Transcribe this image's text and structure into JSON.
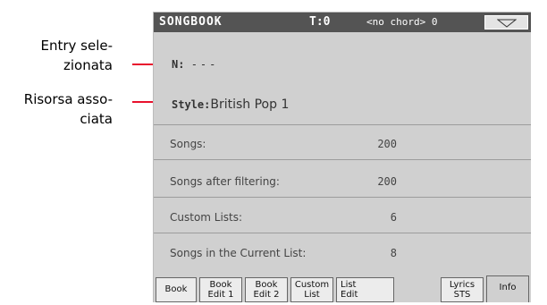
{
  "callouts": [
    {
      "text": "Entry sele-\nzionata"
    },
    {
      "text": "Risorsa asso-\nciata"
    }
  ],
  "titlebar": {
    "title": "SONGBOOK",
    "tempo": "T:0",
    "chord": "<no chord> 0",
    "menu_icon": "triangle-down-icon"
  },
  "entry": {
    "label": "N:",
    "value": "---"
  },
  "style": {
    "label": "Style:",
    "value": "British Pop 1"
  },
  "info": [
    {
      "label": "Songs:",
      "value": "200"
    },
    {
      "label": "Songs after filtering:",
      "value": "200"
    },
    {
      "label": "Custom Lists:",
      "value": "6"
    },
    {
      "label": "Songs in the Current List:",
      "value": "8"
    }
  ],
  "tabs": [
    {
      "line1": "Book",
      "line2": ""
    },
    {
      "line1": "Book",
      "line2": "Edit 1"
    },
    {
      "line1": "Book",
      "line2": "Edit 2"
    },
    {
      "line1": "Custom",
      "line2": "List"
    },
    {
      "line1": "List",
      "line2": "Edit"
    },
    {
      "line1": "Lyrics",
      "line2": "STS"
    },
    {
      "line1": "Info",
      "line2": ""
    }
  ],
  "colors": {
    "callout": "#e8112d",
    "titlebar": "#545454",
    "screen": "#d0d0d0"
  }
}
